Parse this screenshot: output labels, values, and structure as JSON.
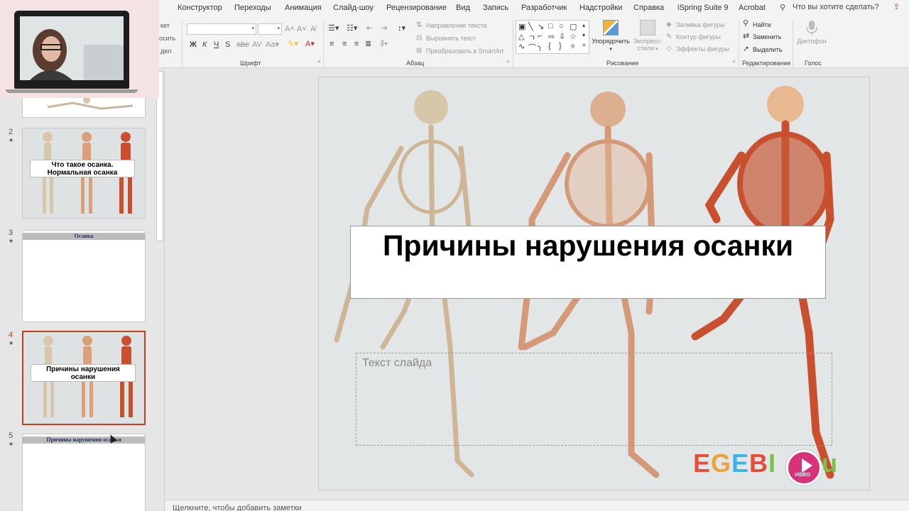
{
  "ribbon_tabs": [
    "Конструктор",
    "Переходы",
    "Анимация",
    "Слайд-шоу",
    "Рецензирование",
    "Вид",
    "Запись",
    "Разработчик",
    "Надстройки",
    "Справка",
    "iSpring Suite 9",
    "Acrobat"
  ],
  "tell_me": "Что вы хотите сделать?",
  "clipboard_partial": [
    "кет",
    "осить",
    "дел"
  ],
  "groups": {
    "font": "Шрифт",
    "paragraph": "Абзац",
    "drawing": "Рисование",
    "editing": "Редактирование",
    "voice": "Голос"
  },
  "paragraph": {
    "text_direction": "Направление текста",
    "align_text": "Выровнять текст",
    "smartart": "Преобразовать в SmartArt"
  },
  "drawing": {
    "arrange": "Упорядочить",
    "quick_styles_1": "Экспресс-",
    "quick_styles_2": "стили",
    "shape_fill": "Заливка фигуры",
    "shape_outline": "Контур фигуры",
    "shape_effects": "Эффекты фигуры"
  },
  "editing": {
    "find": "Найти",
    "replace": "Заменить",
    "select": "Выделить"
  },
  "voice": {
    "dictate": "Диктофон"
  },
  "slides": [
    {
      "num": "2",
      "title": "Что такое осанка.\nНормальная осанка"
    },
    {
      "num": "3",
      "title": "Осанка"
    },
    {
      "num": "4",
      "title": "Причины нарушения\nосанки"
    },
    {
      "num": "5",
      "title": "Причины нарушения осанки"
    }
  ],
  "slide": {
    "title": "Причины нарушения осанки",
    "placeholder": "Текст слайда",
    "logo_letters": [
      "E",
      "G",
      "E",
      "B",
      "I",
      "O",
      ".",
      "r",
      "u"
    ],
    "logo_colors": [
      "#e84c3d",
      "#e8a33d",
      "#3db3e8",
      "#e84c3d",
      "#7cc04b",
      "#7cc04b",
      "#7cc04b",
      "#7cc04b",
      "#7cc04b"
    ],
    "video_label": "VIDEO"
  },
  "notes_placeholder": "Щелкните, чтобы добавить заметки",
  "colors": {
    "accent": "#c43e1c",
    "title_bar": "#1e2a5c"
  }
}
